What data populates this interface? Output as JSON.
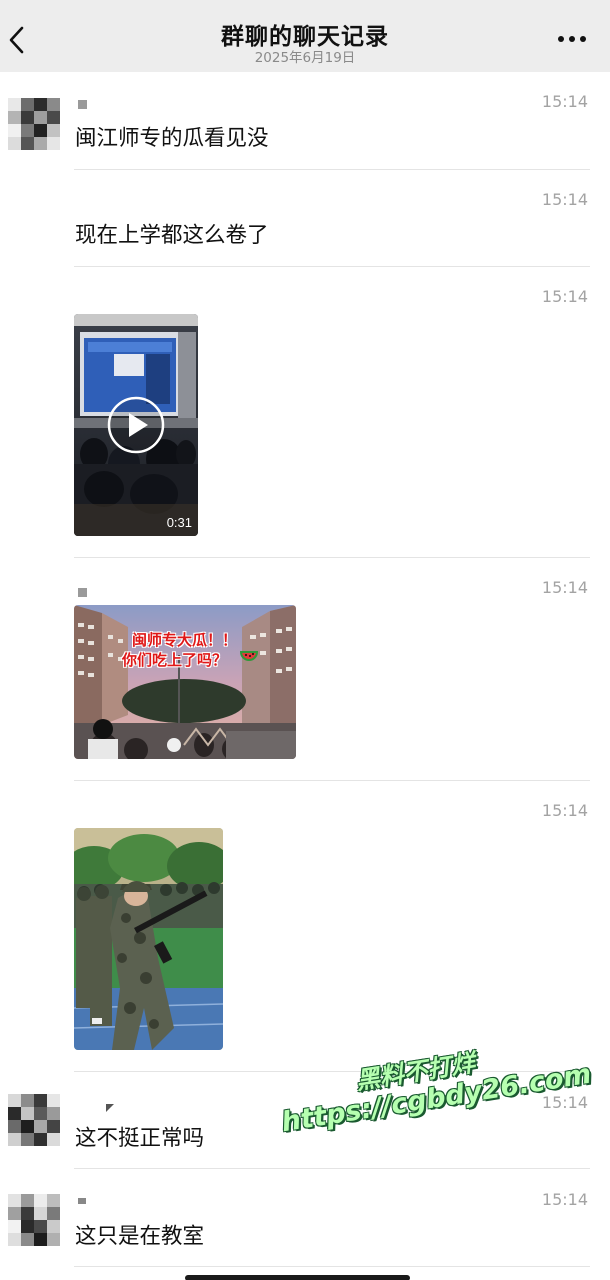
{
  "header": {
    "title": "群聊的聊天记录",
    "date": "2025年6月19日"
  },
  "messages": [
    {
      "time": "15:14",
      "type": "text",
      "text": "闽江师专的瓜看见没"
    },
    {
      "time": "15:14",
      "type": "text",
      "text": "现在上学都这么卷了"
    },
    {
      "time": "15:14",
      "type": "video",
      "duration": "0:31"
    },
    {
      "time": "15:14",
      "type": "image",
      "caption_line1": "闽师专大瓜！！",
      "caption_line2": "你们吃上了吗？"
    },
    {
      "time": "15:14",
      "type": "image"
    },
    {
      "time": "15:14",
      "type": "text",
      "text": "这不挺正常吗"
    },
    {
      "time": "15:14",
      "type": "text",
      "text": "这只是在教室"
    }
  ],
  "watermark": {
    "line1": "黑料不打烊",
    "line2": "https://cgbdy26.com"
  }
}
